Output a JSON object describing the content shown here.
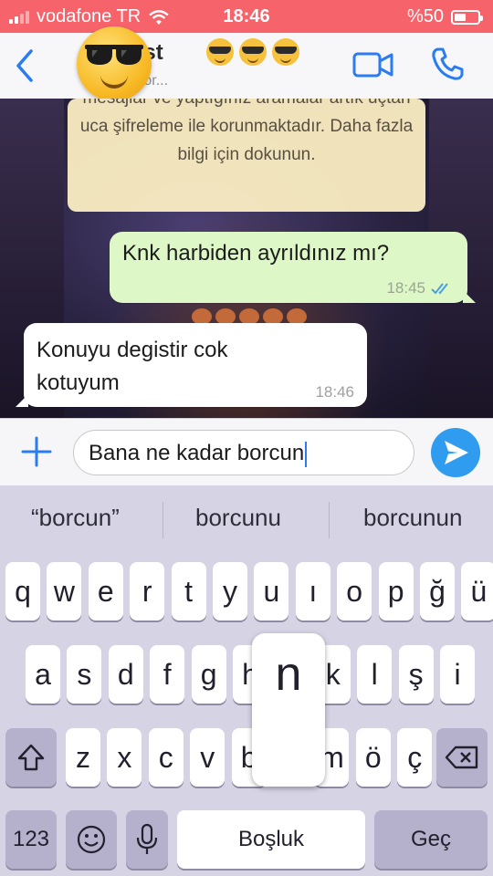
{
  "status_bar": {
    "carrier": "vodafone TR",
    "time": "18:46",
    "battery_text": "%50",
    "battery_level": 0.5,
    "signal_bars_filled": 2,
    "icons": [
      "signal-icon",
      "wifi-icon",
      "battery-icon"
    ]
  },
  "header": {
    "contact_name": "artist",
    "emoji_suffix": [
      "sunglasses-emoji",
      "sunglasses-emoji",
      "sunglasses-emoji"
    ],
    "subtitle": "yazıyor...",
    "back_icon": "chevron-left-icon",
    "video_icon": "video-camera-icon",
    "call_icon": "phone-icon",
    "accent_color": "#2a7cf0"
  },
  "chat": {
    "encryption_notice": "mesajlar ve yaptığınız aramalar artık uçtan uca şifreleme ile korunmaktadır. Daha fazla bilgi için dokunun.",
    "messages": [
      {
        "direction": "outgoing",
        "text": "Knk harbiden ayrıldınız mı?",
        "time": "18:45",
        "status": "read"
      },
      {
        "direction": "incoming",
        "text": "Konuyu degistir cok kotuyum",
        "time": "18:46"
      }
    ],
    "outgoing_bubble_color": "#ddf7c7",
    "incoming_bubble_color": "#ffffff",
    "read_tick_color": "#4aa0e6"
  },
  "input_bar": {
    "value": "Bana ne kadar borcun",
    "plus_icon": "plus-icon",
    "send_icon": "send-icon",
    "send_color": "#2f9cf0"
  },
  "keyboard": {
    "suggestions": [
      "“borcun”",
      "borcunu",
      "borcunun"
    ],
    "rows": [
      [
        "q",
        "w",
        "e",
        "r",
        "t",
        "y",
        "u",
        "ı",
        "o",
        "p",
        "ğ",
        "ü"
      ],
      [
        "a",
        "s",
        "d",
        "f",
        "g",
        "h",
        "j",
        "k",
        "l",
        "ş",
        "i"
      ],
      [
        "z",
        "x",
        "c",
        "v",
        "b",
        "n",
        "m",
        "ö",
        "ç"
      ]
    ],
    "popup_key": "n",
    "shift_icon": "shift-icon",
    "backspace_icon": "backspace-icon",
    "numbers_label": "123",
    "emoji_icon": "emoji-icon",
    "mic_icon": "microphone-icon",
    "space_label": "Boşluk",
    "return_label": "Geç"
  }
}
